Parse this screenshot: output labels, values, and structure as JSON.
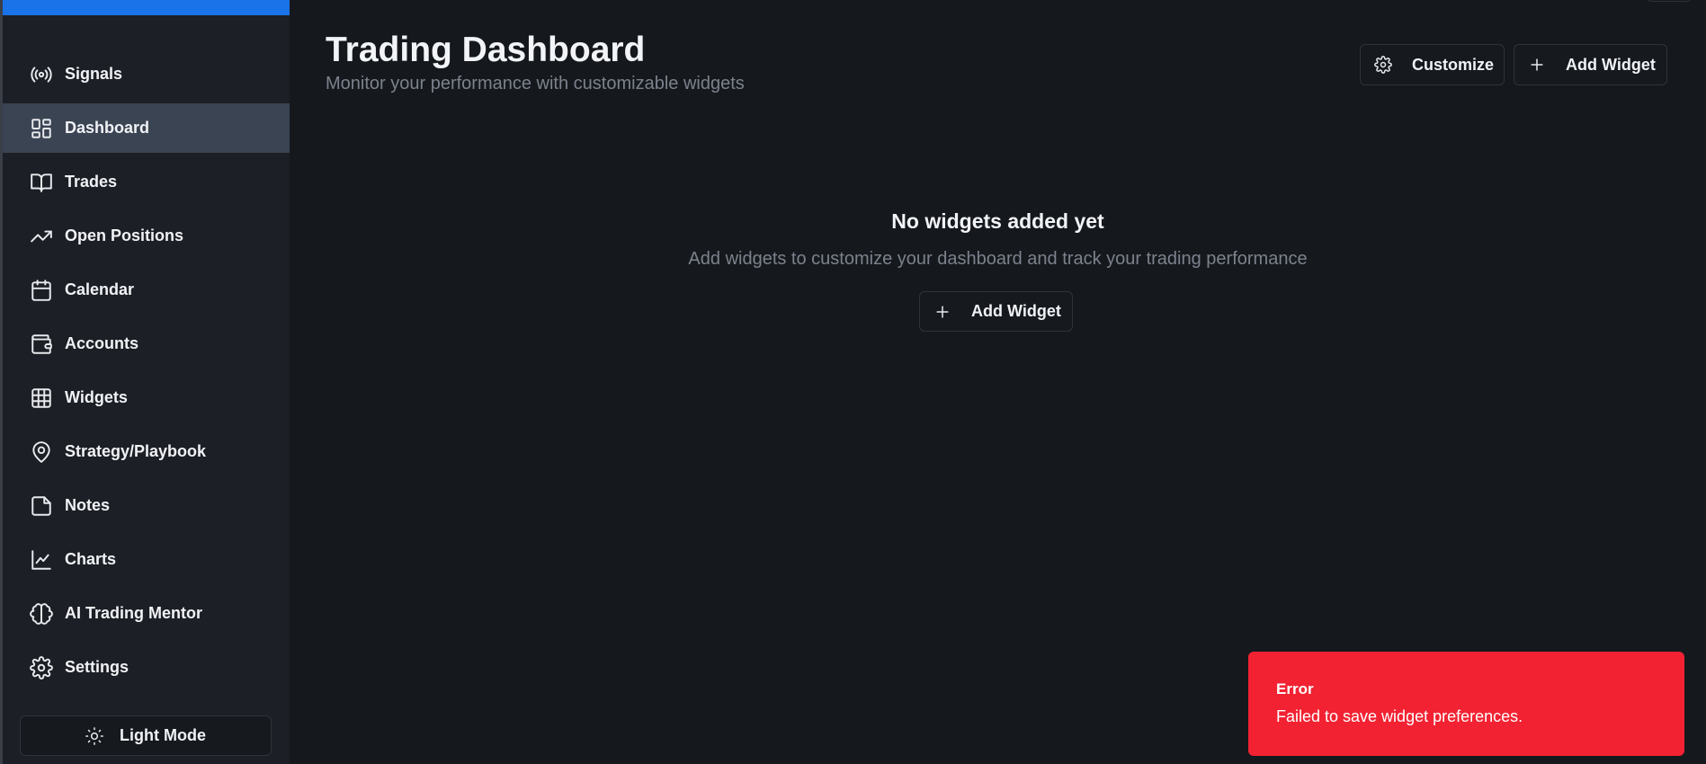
{
  "sidebar": {
    "items": [
      {
        "label": "Signals",
        "icon": "signal-icon",
        "active": false
      },
      {
        "label": "Dashboard",
        "icon": "dashboard-icon",
        "active": true
      },
      {
        "label": "Trades",
        "icon": "book-icon",
        "active": false
      },
      {
        "label": "Open Positions",
        "icon": "trending-up-icon",
        "active": false
      },
      {
        "label": "Calendar",
        "icon": "calendar-icon",
        "active": false
      },
      {
        "label": "Accounts",
        "icon": "wallet-icon",
        "active": false
      },
      {
        "label": "Widgets",
        "icon": "grid-icon",
        "active": false
      },
      {
        "label": "Strategy/Playbook",
        "icon": "map-pin-icon",
        "active": false
      },
      {
        "label": "Notes",
        "icon": "note-icon",
        "active": false
      },
      {
        "label": "Charts",
        "icon": "line-chart-icon",
        "active": false
      },
      {
        "label": "AI Trading Mentor",
        "icon": "brain-icon",
        "active": false
      },
      {
        "label": "Settings",
        "icon": "gear-icon",
        "active": false
      }
    ],
    "theme_toggle": {
      "label": "Light Mode",
      "icon": "sun-icon"
    }
  },
  "header": {
    "title": "Trading Dashboard",
    "subtitle": "Monitor your performance with customizable widgets",
    "customize_label": "Customize",
    "add_widget_label": "Add Widget"
  },
  "empty_state": {
    "title": "No widgets added yet",
    "description": "Add widgets to customize your dashboard and track your trading performance",
    "add_widget_label": "Add Widget"
  },
  "toast": {
    "title": "Error",
    "message": "Failed to save widget preferences."
  },
  "colors": {
    "background": "#15181d",
    "sidebar": "#1c1f25",
    "active_item": "#3a4453",
    "brand": "#1a73e8",
    "error": "#f22232"
  }
}
